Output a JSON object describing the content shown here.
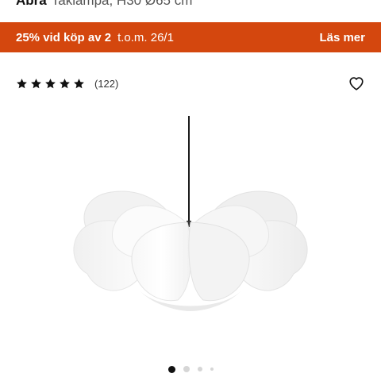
{
  "product": {
    "brand": "Abra",
    "description": "Taklampa, H30 Ø65 cm"
  },
  "promo": {
    "offer": "25% vid köp av 2",
    "date": "t.o.m. 26/1",
    "link": "Läs mer",
    "background": "#d4470e",
    "text_color": "#ffffff"
  },
  "rating": {
    "stars": 5,
    "count": "(122)",
    "star_color": "#111111"
  },
  "favorite": {
    "icon": "heart-icon"
  },
  "gallery": {
    "image": "pendant-lamp-image",
    "total": 4,
    "active": 1
  }
}
